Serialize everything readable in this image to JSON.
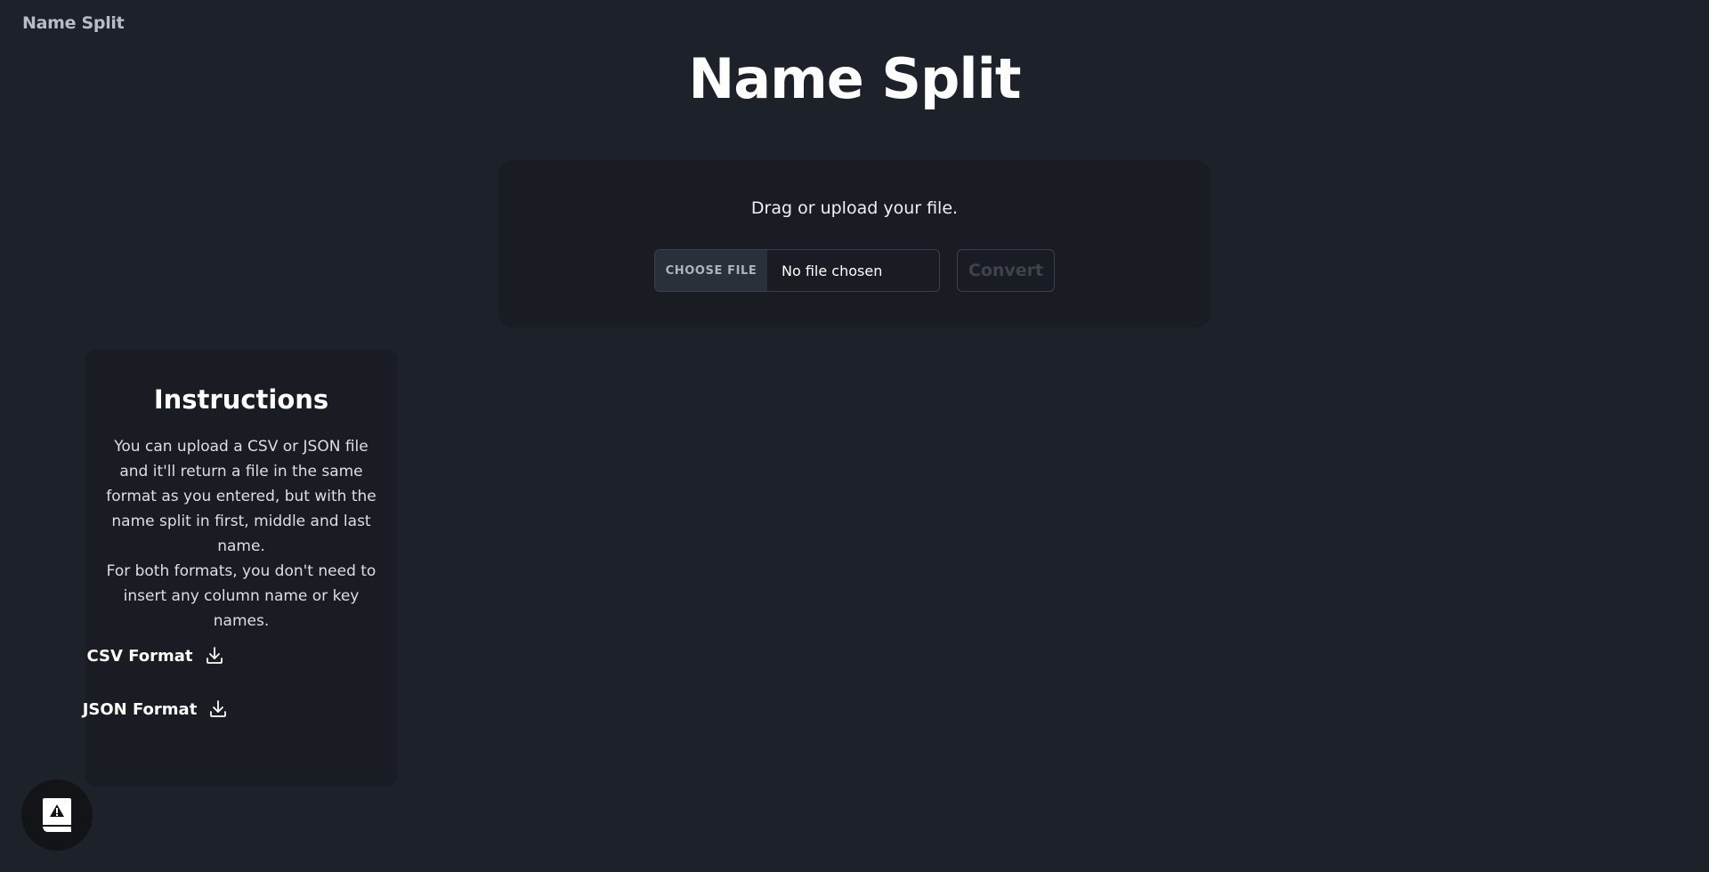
{
  "header": {
    "brand": "Name Split"
  },
  "main": {
    "title": "Name Split"
  },
  "upload": {
    "prompt": "Drag or upload your file.",
    "choose_label": "CHOOSE FILE",
    "file_status": "No file chosen",
    "convert_label": "Convert"
  },
  "instructions": {
    "title": "Instructions",
    "line1": "You can upload a CSV or JSON file and it'll return a file in the same format as you entered, but with the name split in first, middle and last name.",
    "line2": "For both formats, you don't need to insert any column name or key names.",
    "downloads": [
      {
        "label": "CSV Format",
        "icon": "download-icon"
      },
      {
        "label": "JSON Format",
        "icon": "download-icon"
      }
    ]
  },
  "fab": {
    "icon": "report-book-icon"
  },
  "colors": {
    "background": "#1d222a",
    "card": "#191c23",
    "border": "#3b414c",
    "text": "#ffffff",
    "muted": "#b8bcc4",
    "disabled": "#3d434d"
  }
}
